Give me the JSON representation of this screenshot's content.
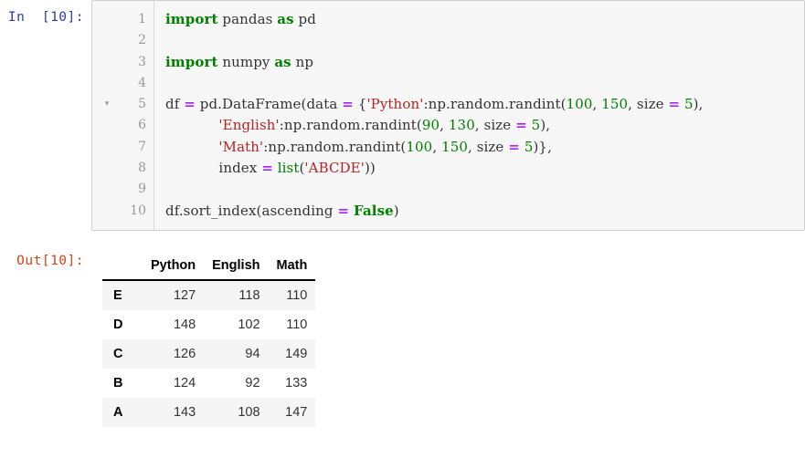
{
  "cell": {
    "input_prompt": "In  [10]:",
    "output_prompt": "Out[10]:",
    "fold_marker_icon": "triangle-down-icon",
    "fold_marker_glyph": "▾",
    "fold_marker_line": 5,
    "line_numbers": [
      "1",
      "2",
      "3",
      "4",
      "5",
      "6",
      "7",
      "8",
      "9",
      "10"
    ],
    "code_lines": [
      {
        "number": "1",
        "tokens": [
          {
            "t": "import",
            "c": "k"
          },
          {
            "t": " pandas ",
            "c": "n"
          },
          {
            "t": "as",
            "c": "k"
          },
          {
            "t": " pd",
            "c": "n"
          }
        ]
      },
      {
        "number": "2",
        "tokens": []
      },
      {
        "number": "3",
        "tokens": [
          {
            "t": "import",
            "c": "k"
          },
          {
            "t": " numpy ",
            "c": "n"
          },
          {
            "t": "as",
            "c": "k"
          },
          {
            "t": " np",
            "c": "n"
          }
        ]
      },
      {
        "number": "4",
        "tokens": []
      },
      {
        "number": "5",
        "tokens": [
          {
            "t": "df ",
            "c": "n"
          },
          {
            "t": "=",
            "c": "op"
          },
          {
            "t": " pd.DataFrame(data ",
            "c": "n"
          },
          {
            "t": "=",
            "c": "op"
          },
          {
            "t": " {",
            "c": "p"
          },
          {
            "t": "'Python'",
            "c": "s"
          },
          {
            "t": ":np.random.randint(",
            "c": "n"
          },
          {
            "t": "100",
            "c": "mi"
          },
          {
            "t": ", ",
            "c": "p"
          },
          {
            "t": "150",
            "c": "mi"
          },
          {
            "t": ", size ",
            "c": "n"
          },
          {
            "t": "=",
            "c": "op"
          },
          {
            "t": " ",
            "c": "n"
          },
          {
            "t": "5",
            "c": "mi"
          },
          {
            "t": "),",
            "c": "p"
          }
        ]
      },
      {
        "number": "6",
        "tokens": [
          {
            "t": "            ",
            "c": "n"
          },
          {
            "t": "'English'",
            "c": "s"
          },
          {
            "t": ":np.random.randint(",
            "c": "n"
          },
          {
            "t": "90",
            "c": "mi"
          },
          {
            "t": ", ",
            "c": "p"
          },
          {
            "t": "130",
            "c": "mi"
          },
          {
            "t": ", size ",
            "c": "n"
          },
          {
            "t": "=",
            "c": "op"
          },
          {
            "t": " ",
            "c": "n"
          },
          {
            "t": "5",
            "c": "mi"
          },
          {
            "t": "),",
            "c": "p"
          }
        ]
      },
      {
        "number": "7",
        "tokens": [
          {
            "t": "            ",
            "c": "n"
          },
          {
            "t": "'Math'",
            "c": "s"
          },
          {
            "t": ":np.random.randint(",
            "c": "n"
          },
          {
            "t": "100",
            "c": "mi"
          },
          {
            "t": ", ",
            "c": "p"
          },
          {
            "t": "150",
            "c": "mi"
          },
          {
            "t": ", size ",
            "c": "n"
          },
          {
            "t": "=",
            "c": "op"
          },
          {
            "t": " ",
            "c": "n"
          },
          {
            "t": "5",
            "c": "mi"
          },
          {
            "t": ")},",
            "c": "p"
          }
        ]
      },
      {
        "number": "8",
        "tokens": [
          {
            "t": "            index ",
            "c": "n"
          },
          {
            "t": "=",
            "c": "op"
          },
          {
            "t": " ",
            "c": "n"
          },
          {
            "t": "list",
            "c": "nb"
          },
          {
            "t": "(",
            "c": "p"
          },
          {
            "t": "'ABCDE'",
            "c": "s"
          },
          {
            "t": "))",
            "c": "p"
          }
        ]
      },
      {
        "number": "9",
        "tokens": []
      },
      {
        "number": "10",
        "tokens": [
          {
            "t": "df.sort_index(ascending ",
            "c": "n"
          },
          {
            "t": "=",
            "c": "op"
          },
          {
            "t": " ",
            "c": "n"
          },
          {
            "t": "False",
            "c": "k"
          },
          {
            "t": ")",
            "c": "p"
          }
        ]
      }
    ],
    "code_plain": "import pandas as pd\n\nimport numpy as np\n\ndf = pd.DataFrame(data = {'Python':np.random.randint(100, 150, size = 5),\n            'English':np.random.randint(90, 130, size = 5),\n            'Math':np.random.randint(100, 150, size = 5)},\n            index = list('ABCDE'))\n\ndf.sort_index(ascending = False)"
  },
  "output_table": {
    "corner_label": "",
    "columns": [
      "Python",
      "English",
      "Math"
    ],
    "index": [
      "E",
      "D",
      "C",
      "B",
      "A"
    ],
    "rows": [
      {
        "index": "E",
        "values": [
          "127",
          "118",
          "110"
        ]
      },
      {
        "index": "D",
        "values": [
          "148",
          "102",
          "110"
        ]
      },
      {
        "index": "C",
        "values": [
          "126",
          "94",
          "149"
        ]
      },
      {
        "index": "B",
        "values": [
          "124",
          "92",
          "133"
        ]
      },
      {
        "index": "A",
        "values": [
          "143",
          "108",
          "147"
        ]
      }
    ]
  },
  "colors": {
    "prompt_in": "#2f39a8",
    "prompt_out": "#d84315",
    "keyword": "#008000",
    "string": "#ba2121",
    "number": "#008000",
    "operator": "#aa22ff",
    "cell_background": "#f7f7f7",
    "cell_border": "#cfcfcf",
    "row_stripe": "#f5f5f5"
  }
}
